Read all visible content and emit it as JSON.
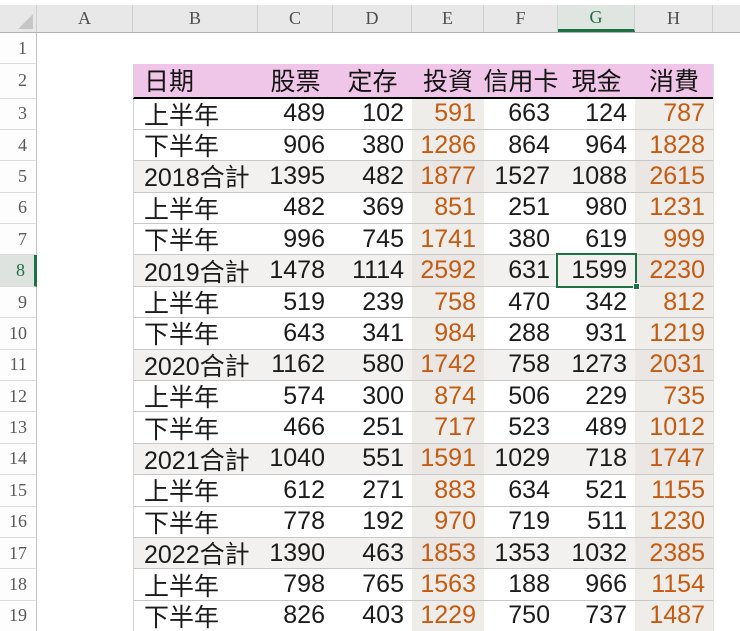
{
  "sheet": {
    "column_headers": [
      "A",
      "B",
      "C",
      "D",
      "E",
      "F",
      "G",
      "H"
    ],
    "selected_column": "G",
    "selected_row_number": "8",
    "active_cell_value": "1599",
    "empty_row_number": "1",
    "header_row_number": "2"
  },
  "colors": {
    "header_fill_pink": "#f0c6e8",
    "accent_green": "#1e7145",
    "highlight_orange": "#c55a11",
    "total_row_gray": "#f2f1f0",
    "shaded_column_gray": "#efede9"
  },
  "table": {
    "headers": {
      "date": "日期",
      "cols": [
        "股票",
        "定存",
        "投資",
        "信用卡",
        "現金",
        "消費"
      ]
    },
    "rows": [
      {
        "row": "3",
        "label": "上半年",
        "is_total": false,
        "values": [
          "489",
          "102",
          "591",
          "663",
          "124",
          "787"
        ]
      },
      {
        "row": "4",
        "label": "下半年",
        "is_total": false,
        "values": [
          "906",
          "380",
          "1286",
          "864",
          "964",
          "1828"
        ]
      },
      {
        "row": "5",
        "label": "2018合計",
        "is_total": true,
        "values": [
          "1395",
          "482",
          "1877",
          "1527",
          "1088",
          "2615"
        ]
      },
      {
        "row": "6",
        "label": "上半年",
        "is_total": false,
        "values": [
          "482",
          "369",
          "851",
          "251",
          "980",
          "1231"
        ]
      },
      {
        "row": "7",
        "label": "下半年",
        "is_total": false,
        "values": [
          "996",
          "745",
          "1741",
          "380",
          "619",
          "999"
        ]
      },
      {
        "row": "8",
        "label": "2019合計",
        "is_total": true,
        "values": [
          "1478",
          "1114",
          "2592",
          "631",
          "1599",
          "2230"
        ]
      },
      {
        "row": "9",
        "label": "上半年",
        "is_total": false,
        "values": [
          "519",
          "239",
          "758",
          "470",
          "342",
          "812"
        ]
      },
      {
        "row": "10",
        "label": "下半年",
        "is_total": false,
        "values": [
          "643",
          "341",
          "984",
          "288",
          "931",
          "1219"
        ]
      },
      {
        "row": "11",
        "label": "2020合計",
        "is_total": true,
        "values": [
          "1162",
          "580",
          "1742",
          "758",
          "1273",
          "2031"
        ]
      },
      {
        "row": "12",
        "label": "上半年",
        "is_total": false,
        "values": [
          "574",
          "300",
          "874",
          "506",
          "229",
          "735"
        ]
      },
      {
        "row": "13",
        "label": "下半年",
        "is_total": false,
        "values": [
          "466",
          "251",
          "717",
          "523",
          "489",
          "1012"
        ]
      },
      {
        "row": "14",
        "label": "2021合計",
        "is_total": true,
        "values": [
          "1040",
          "551",
          "1591",
          "1029",
          "718",
          "1747"
        ]
      },
      {
        "row": "15",
        "label": "上半年",
        "is_total": false,
        "values": [
          "612",
          "271",
          "883",
          "634",
          "521",
          "1155"
        ]
      },
      {
        "row": "16",
        "label": "下半年",
        "is_total": false,
        "values": [
          "778",
          "192",
          "970",
          "719",
          "511",
          "1230"
        ]
      },
      {
        "row": "17",
        "label": "2022合計",
        "is_total": true,
        "values": [
          "1390",
          "463",
          "1853",
          "1353",
          "1032",
          "2385"
        ]
      },
      {
        "row": "18",
        "label": "上半年",
        "is_total": false,
        "values": [
          "798",
          "765",
          "1563",
          "188",
          "966",
          "1154"
        ]
      },
      {
        "row": "19",
        "label": "下半年",
        "is_total": false,
        "values": [
          "826",
          "403",
          "1229",
          "750",
          "737",
          "1487"
        ]
      }
    ]
  }
}
